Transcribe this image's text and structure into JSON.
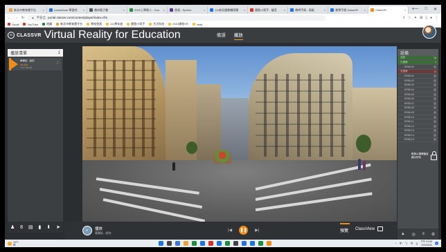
{
  "browser": {
    "tabs": [
      {
        "label": "新北市教育雲平台",
        "color": "#e8a33a"
      },
      {
        "label": "LearnMode 學習吧",
        "color": "#2a6fd6"
      },
      {
        "label": "教材電子書",
        "color": "#555555"
      },
      {
        "label": "2022上學期八 - Goo",
        "color": "#1e8e3e"
      },
      {
        "label": "首頁 - Sphere",
        "color": "#5a3a8a"
      },
      {
        "label": "111新北國教輔導團",
        "color": "#1a73e8"
      },
      {
        "label": "聽歌小幫手 - 聲音",
        "color": "#d93025"
      },
      {
        "label": "教師手冊 - 高級",
        "color": "#1a73e8"
      },
      {
        "label": "教學手冊 ClassVR",
        "color": "#1a73e8"
      },
      {
        "label": "ClassVR",
        "color": "#f08c1a"
      }
    ],
    "new_tab": "+",
    "window_controls": [
      "—",
      "□",
      "✕"
    ],
    "url_security": "不安全",
    "url": "portal.classvr.com/content/player/index.cfm",
    "bookmarks": [
      {
        "label": "Gmail",
        "color": "#d93025"
      },
      {
        "label": "YouTube",
        "color": "#d93025"
      },
      {
        "label": "地圖",
        "color": "#1e8e3e"
      },
      {
        "label": "新北市教育雲平台",
        "color": "#e8a33a"
      },
      {
        "label": "學校首頁",
        "color": "#f5c242"
      },
      {
        "label": "111學年度",
        "color": "#f5c242"
      },
      {
        "label": "聽歌小幫手",
        "color": "#f5c242"
      },
      {
        "label": "生活科技",
        "color": "#f5c242"
      },
      {
        "label": "2022課程VR",
        "color": "#f5c242"
      },
      {
        "label": "India",
        "color": "#f5c242"
      }
    ]
  },
  "app": {
    "logo_text": "CLASSVR",
    "logo_sub": "Virtual Reality for Education",
    "nav": [
      "備課",
      "播放"
    ],
    "active_nav": "播放"
  },
  "playlist": {
    "header": "播放清單",
    "count": "1",
    "items": [
      {
        "title": "華爾街 - 紐約",
        "sub": "360 影片",
        "meta": "2:13 | 360 影"
      }
    ],
    "toolbar": [
      "♟",
      "8",
      "▤",
      "▮",
      "⬇",
      "➤"
    ]
  },
  "devices": {
    "header": "設備",
    "groups": [
      {
        "label": "全部",
        "count": "16",
        "style": "green"
      },
      {
        "label": "已連線",
        "count": "1",
        "style": "green"
      },
      {
        "label": "ER55-00",
        "count": "",
        "style": "sub"
      },
      {
        "label": "未連線",
        "count": "15",
        "style": "red"
      },
      {
        "label": "ER55-01",
        "count": "",
        "style": "sub"
      },
      {
        "label": "ER55-02",
        "count": "",
        "style": "sub"
      },
      {
        "label": "ER55-03",
        "count": "",
        "style": "sub"
      },
      {
        "label": "ER55-04",
        "count": "",
        "style": "sub"
      },
      {
        "label": "ER55-05",
        "count": "",
        "style": "sub"
      },
      {
        "label": "ER55-06",
        "count": "",
        "style": "sub"
      },
      {
        "label": "ER55-07",
        "count": "",
        "style": "sub"
      },
      {
        "label": "ER55-08",
        "count": "",
        "style": "sub"
      },
      {
        "label": "ER55-09",
        "count": "",
        "style": "sub"
      },
      {
        "label": "ER55-10",
        "count": "",
        "style": "sub"
      },
      {
        "label": "ER55-11",
        "count": "",
        "style": "sub"
      },
      {
        "label": "ER55-12",
        "count": "",
        "style": "sub"
      },
      {
        "label": "ER55-13",
        "count": "",
        "style": "sub"
      },
      {
        "label": "ER55-14",
        "count": "",
        "style": "sub"
      },
      {
        "label": "ER55-15",
        "count": "",
        "style": "sub"
      }
    ],
    "lock_text_1": "點擊以選擇播放",
    "lock_text_2": "顯示所有",
    "bottom_icons": [
      "▲",
      "◎",
      "≡",
      "⚙"
    ]
  },
  "player": {
    "now_playing": "播放",
    "now_playing_sub": "華爾街 - 紐約",
    "prev": "|◀",
    "pause": "❚❚",
    "next": "▶|",
    "preview_label": "預覽",
    "classview_label": "ClassView"
  },
  "taskbar": {
    "temp": "34°C",
    "weather": "晴",
    "app_colors": [
      "#1a73e8",
      "#444444",
      "#3a78d8",
      "#e8a33a",
      "#1e8e3e",
      "#1a73e8",
      "#d93025",
      "#1a73e8",
      "#1e8e3e",
      "#444444",
      "#2a6fd6",
      "#1a73e8",
      "#1e8e3e",
      "#f08c1a"
    ],
    "tray": [
      "^",
      "中",
      "ㄅ",
      "令",
      "(("
    ],
    "time": "下午 01:56",
    "date": "2022/8/30",
    "notif": "3"
  },
  "colors": {
    "accent": "#f08c1a",
    "connected": "#3e6a3a",
    "disconnected": "#6a3a3a"
  }
}
